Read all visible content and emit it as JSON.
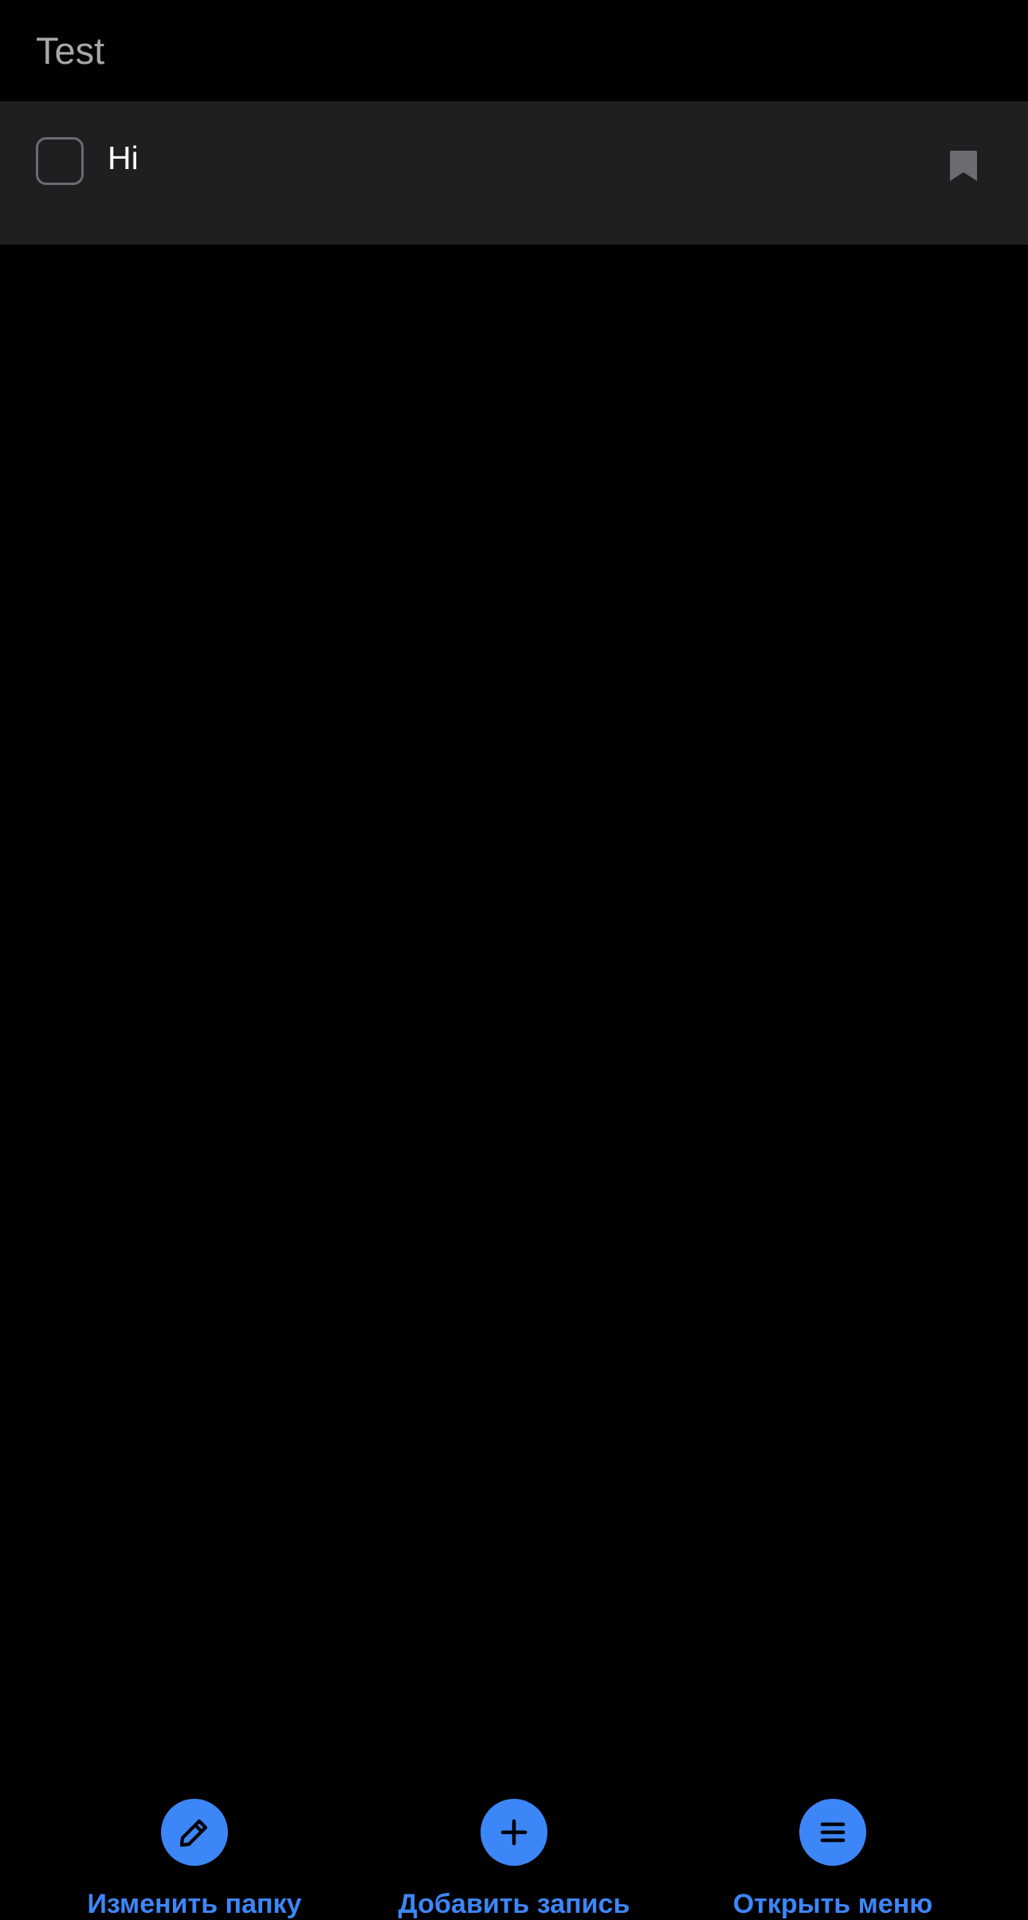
{
  "header": {
    "title": "Test"
  },
  "entries": [
    {
      "text": "Hi",
      "checked": false,
      "bookmark_icon": "bookmark-icon"
    }
  ],
  "toolbar": {
    "edit_folder_label": "Изменить папку",
    "edit_folder_icon": "pencil-icon",
    "add_entry_label": "Добавить запись",
    "add_entry_icon": "plus-icon",
    "open_menu_label": "Открыть меню",
    "open_menu_icon": "hamburger-menu-icon"
  },
  "colors": {
    "background": "#000000",
    "row_background": "#1f1f21",
    "title_text": "#a6a6ab",
    "accent": "#3d86f7",
    "checkbox_border": "#6c6c70",
    "bookmark": "#6c6c70"
  }
}
